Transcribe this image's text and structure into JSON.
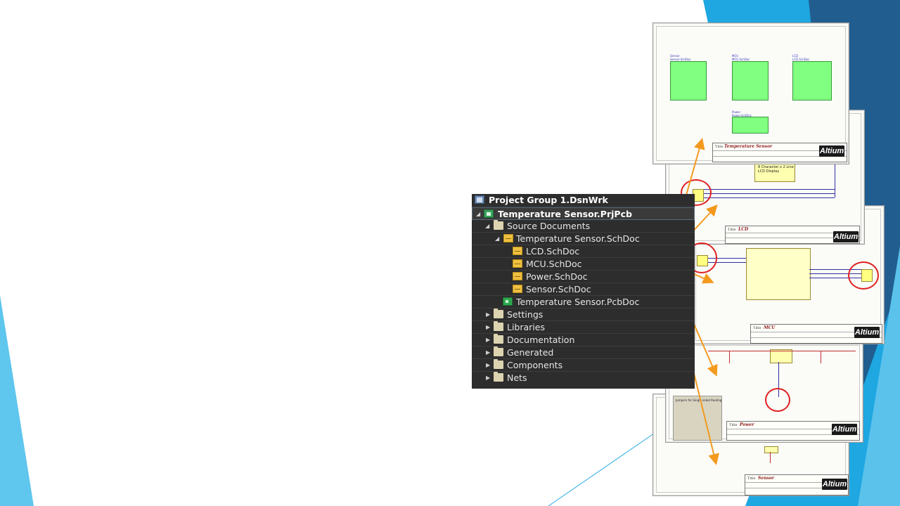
{
  "tree": {
    "group": "Project Group 1.DsnWrk",
    "project": "Temperature Sensor.PrjPcb",
    "source_documents": "Source Documents",
    "top_sheet": "Temperature Sensor.SchDoc",
    "children": [
      "LCD.SchDoc",
      "MCU.SchDoc",
      "Power.SchDoc",
      "Sensor.SchDoc"
    ],
    "pcb": "Temperature Sensor.PcbDoc",
    "folders": [
      "Settings",
      "Libraries",
      "Documentation",
      "Generated",
      "Components",
      "Nets"
    ]
  },
  "sheets": {
    "top": {
      "title": "Temperature Sensor",
      "logo": "Altium",
      "blocks": [
        {
          "cap1": "Sensor",
          "cap2": "Sensor.SchDoc"
        },
        {
          "cap1": "MCU",
          "cap2": "MCU.SchDoc"
        },
        {
          "cap1": "LCD",
          "cap2": "LCD.SchDoc"
        },
        {
          "cap1": "Power",
          "cap2": "Power.SchDoc"
        }
      ]
    },
    "lcd": {
      "title": "LCD",
      "logo": "Altium",
      "display_line1": "8 Character x 2 Line",
      "display_line2": "LCD Display"
    },
    "mcu": {
      "title": "MCU",
      "logo": "Altium"
    },
    "power": {
      "title": "Power",
      "logo": "Altium",
      "jumpers_label": "Jumpers for Single-sided Routing"
    },
    "sensor": {
      "title": "Sensor",
      "logo": "Altium"
    }
  },
  "colors": {
    "panel_bg": "#2d2d2d",
    "arrow": "#f39a1e",
    "highlight_circle": "#e02020",
    "accent_blue": "#29abe2",
    "accent_dark": "#1f5c8c",
    "sheet_block": "#80ff80"
  }
}
